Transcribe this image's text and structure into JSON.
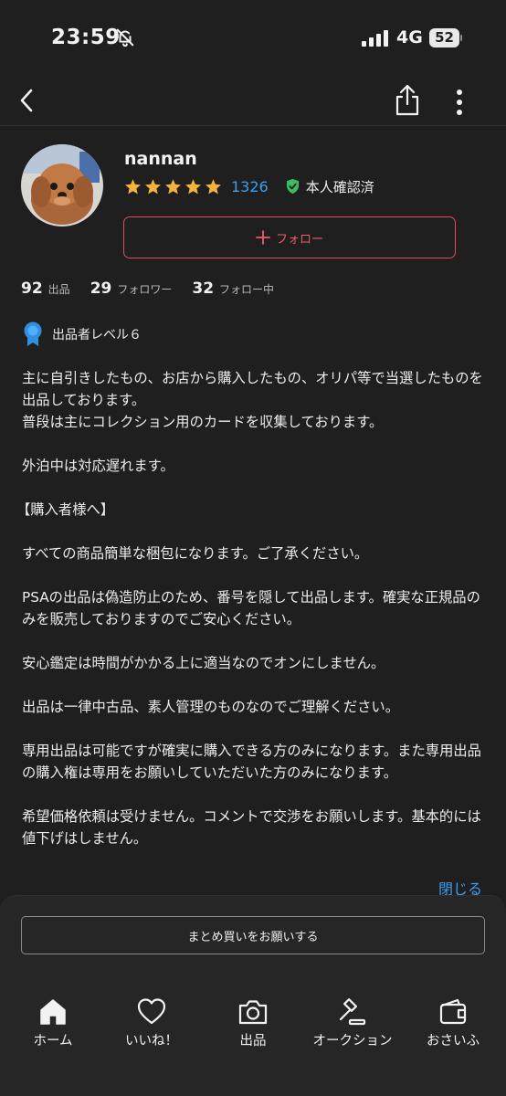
{
  "status_bar": {
    "time": "23:59",
    "network": "4G",
    "battery": "52"
  },
  "profile": {
    "username": "nannan",
    "rating_count": "1326",
    "verified_label": "本人確認済",
    "follow_label": "フォロー"
  },
  "stats": [
    {
      "value": "92",
      "label": "出品"
    },
    {
      "value": "29",
      "label": "フォロワー"
    },
    {
      "value": "32",
      "label": "フォロー中"
    }
  ],
  "seller_level": "出品者レベル６",
  "bio": [
    "主に自引きしたもの、お店から購入したもの、オリパ等で当選したものを出品しております。\n普段は主にコレクション用のカードを収集しております。",
    "外泊中は対応遅れます。",
    "【購入者様へ】",
    "すべての商品簡単な梱包になります。ご了承ください。",
    "PSAの出品は偽造防止のため、番号を隠して出品します。確実な正規品のみを販売しておりますのでご安心ください。",
    "安心鑑定は時間がかかる上に適当なのでオンにしません。",
    "出品は一律中古品、素人管理のものなのでご理解ください。",
    "専用出品は可能ですが確実に購入できる方のみになります。また専用出品の購入権は専用をお願いしていただいた方のみになります。",
    "希望価格依頼は受けません。コメントで交渉をお願いします。基本的には値下げはしません。"
  ],
  "close_label": "閉じる",
  "bulk_button_label": "まとめ買いをお願いする",
  "tabs": [
    {
      "label": "ホーム",
      "icon": "home-icon"
    },
    {
      "label": "いいね！",
      "icon": "heart-icon"
    },
    {
      "label": "出品",
      "icon": "camera-icon"
    },
    {
      "label": "オークション",
      "icon": "gavel-icon"
    },
    {
      "label": "おさいふ",
      "icon": "wallet-icon"
    }
  ],
  "colors": {
    "background": "#1f1f1f",
    "accent_red": "#e8485f",
    "link_blue": "#3d9ef2",
    "star_gold": "#f3b33d",
    "verified_green": "#3dbb63",
    "level_blue": "#2f8fe0"
  }
}
